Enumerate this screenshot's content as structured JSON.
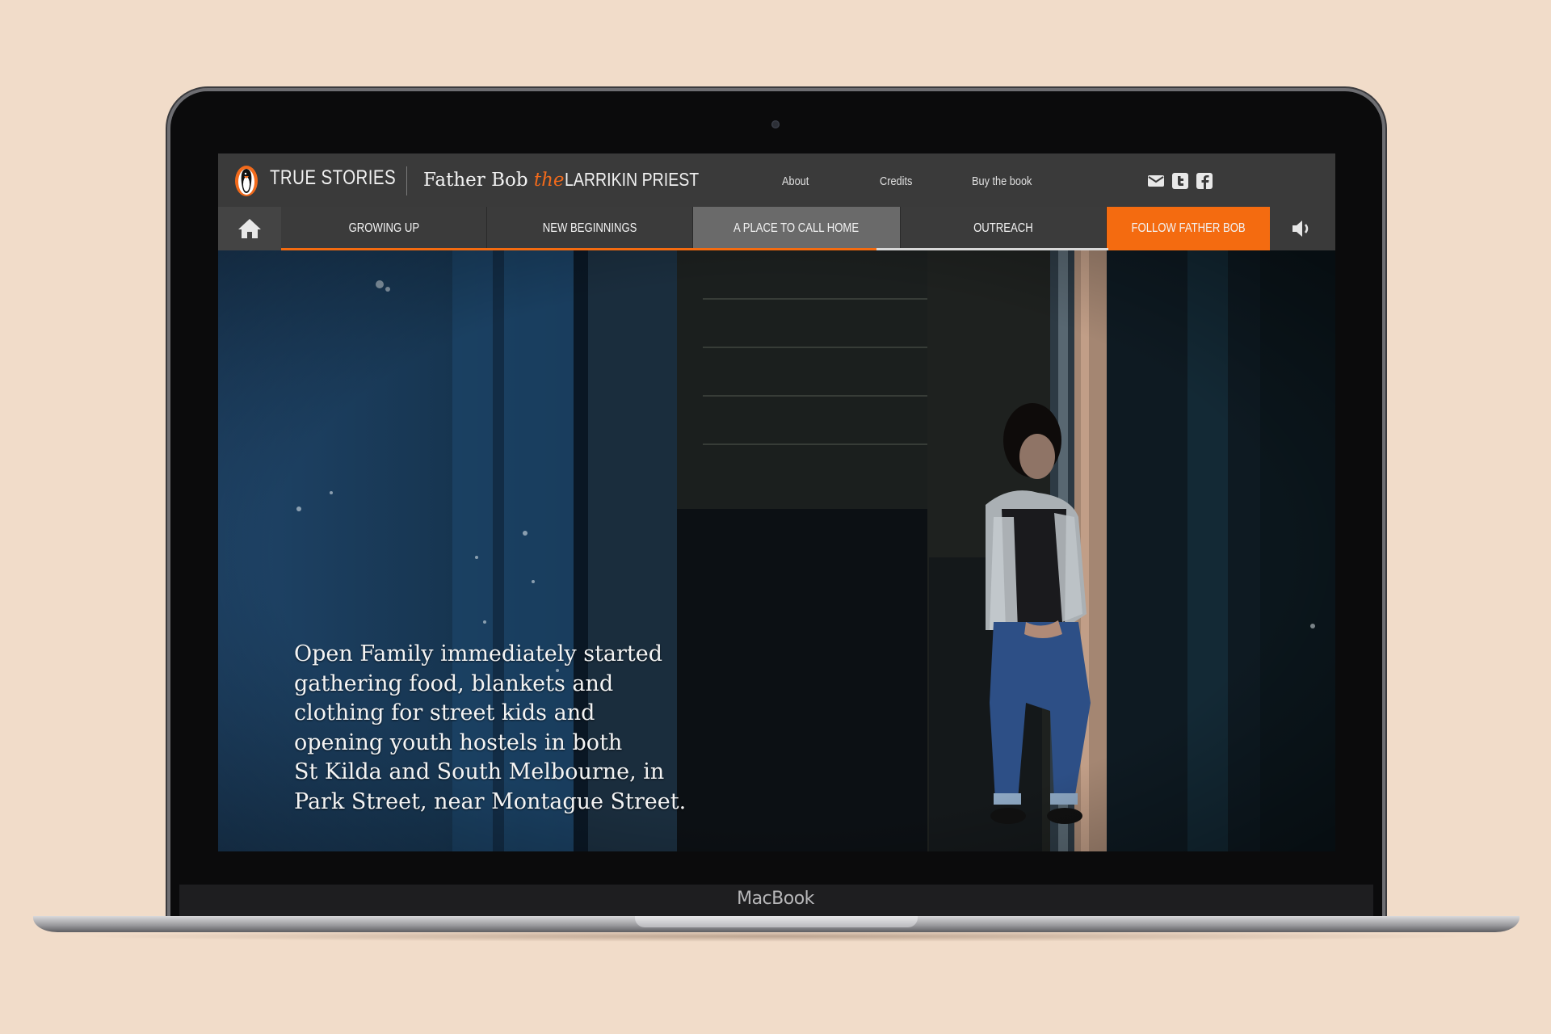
{
  "device": {
    "label": "MacBook"
  },
  "header": {
    "brand": "TRUE STORIES",
    "title_part1": "Father Bob ",
    "title_the": "the",
    "title_part2": " LARRIKIN PRIEST",
    "links": [
      "About",
      "Credits",
      "Buy the book"
    ],
    "social_icons": [
      "email-icon",
      "twitter-icon",
      "facebook-icon"
    ]
  },
  "nav": {
    "home_icon": "home-icon",
    "tabs": [
      {
        "label": "GROWING UP"
      },
      {
        "label": "NEW BEGINNINGS"
      },
      {
        "label": "A PLACE TO CALL HOME",
        "active": true
      },
      {
        "label": "OUTREACH"
      },
      {
        "label": "FOLLOW FATHER BOB"
      }
    ],
    "sound_icon": "speaker-icon",
    "progress_percent": 72,
    "accent_color": "#f46b10"
  },
  "hero": {
    "caption_lines": [
      "Open Family immediately started",
      "gathering food, blankets and",
      "clothing for street kids and",
      "opening youth hostels in both",
      "St Kilda and South Melbourne, in",
      "Park Street, near Montague Street."
    ]
  }
}
